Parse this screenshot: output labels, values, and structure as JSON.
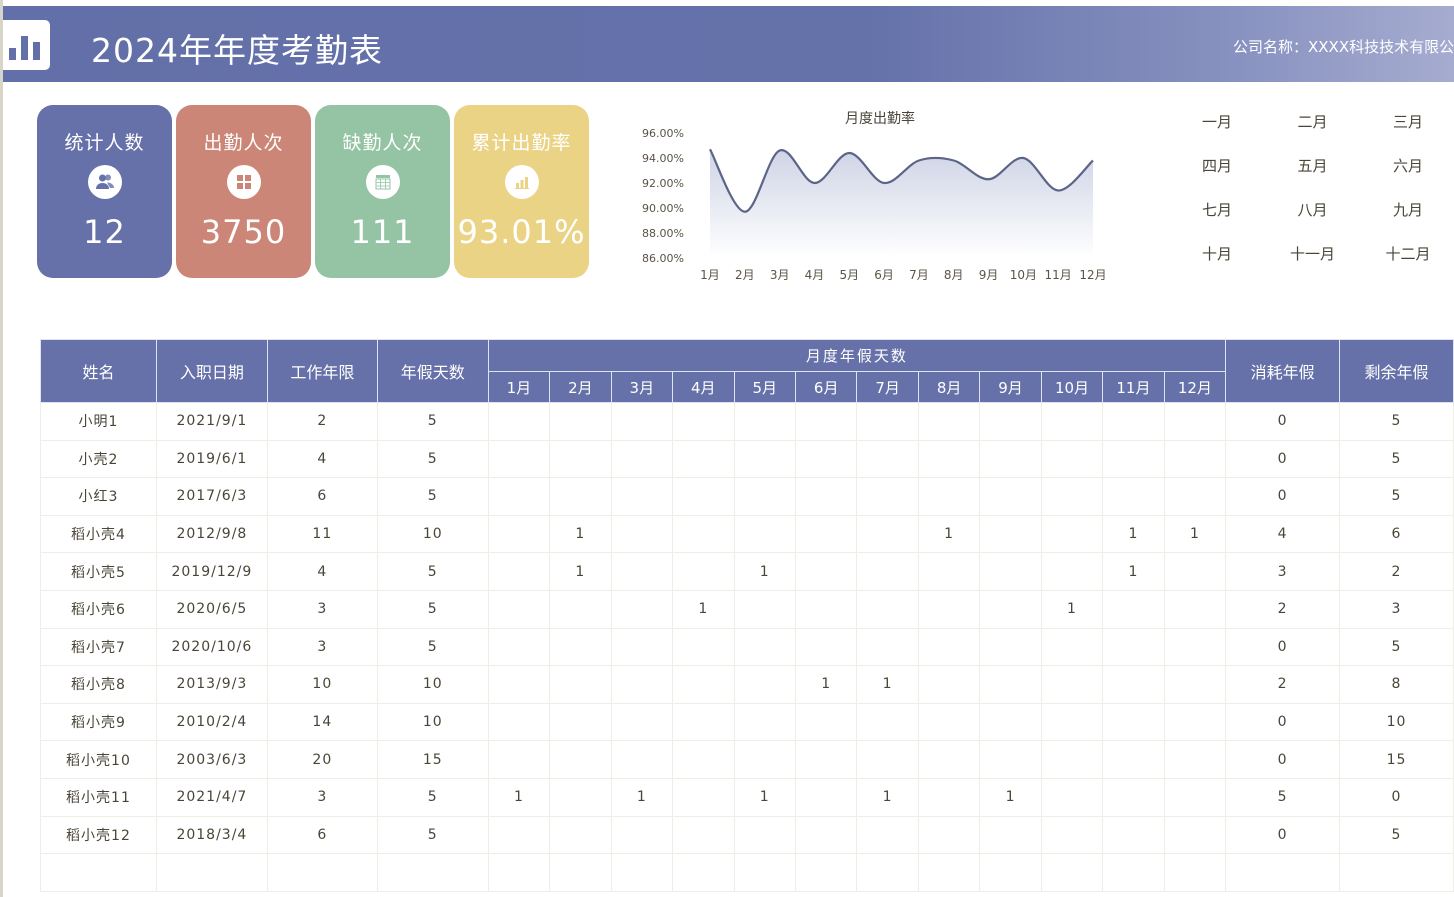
{
  "header": {
    "title": "2024年年度考勤表",
    "company": "公司名称：XXXX科技技术有限公",
    "logo_icon": "bar-chart-icon"
  },
  "kpis": [
    {
      "label": "统计人数",
      "value": "12",
      "icon": "users-icon",
      "color": "#6571a8"
    },
    {
      "label": "出勤人次",
      "value": "3750",
      "icon": "grid-icon",
      "color": "#cc8677"
    },
    {
      "label": "缺勤人次",
      "value": "111",
      "icon": "calendar-table-icon",
      "color": "#94c4a4"
    },
    {
      "label": "累计出勤率",
      "value": "93.01%",
      "icon": "bar-chart-icon",
      "color": "#ebd386"
    }
  ],
  "chart_data": {
    "type": "area",
    "title": "月度出勤率",
    "categories": [
      "1月",
      "2月",
      "3月",
      "4月",
      "5月",
      "6月",
      "7月",
      "8月",
      "9月",
      "10月",
      "11月",
      "12月"
    ],
    "series": [
      {
        "name": "出勤率",
        "values": [
          94.7,
          89.7,
          94.6,
          92.0,
          94.4,
          92.0,
          93.8,
          93.8,
          92.3,
          94.0,
          91.4,
          93.8
        ]
      }
    ],
    "ylim": [
      86,
      96
    ],
    "yticks": [
      "96.00%",
      "94.00%",
      "92.00%",
      "90.00%",
      "88.00%",
      "86.00%"
    ],
    "xlabel": "",
    "ylabel": "",
    "grid": false,
    "line_color": "#5c6488",
    "fill_color": "#c9cfe3"
  },
  "month_selector": [
    "一月",
    "二月",
    "三月",
    "四月",
    "五月",
    "六月",
    "七月",
    "八月",
    "九月",
    "十月",
    "十一月",
    "十二月"
  ],
  "table": {
    "headers": {
      "name": "姓名",
      "hire_date": "入职日期",
      "years": "工作年限",
      "leave_days": "年假天数",
      "monthly_group": "月度年假天数",
      "used": "消耗年假",
      "remaining": "剩余年假"
    },
    "months": [
      "1月",
      "2月",
      "3月",
      "4月",
      "5月",
      "6月",
      "7月",
      "8月",
      "9月",
      "10月",
      "11月",
      "12月"
    ],
    "rows": [
      {
        "name": "小明1",
        "hire_date": "2021/9/1",
        "years": "2",
        "leave_days": "5",
        "monthly": [
          "",
          "",
          "",
          "",
          "",
          "",
          "",
          "",
          "",
          "",
          "",
          ""
        ],
        "used": "0",
        "remaining": "5"
      },
      {
        "name": "小壳2",
        "hire_date": "2019/6/1",
        "years": "4",
        "leave_days": "5",
        "monthly": [
          "",
          "",
          "",
          "",
          "",
          "",
          "",
          "",
          "",
          "",
          "",
          ""
        ],
        "used": "0",
        "remaining": "5"
      },
      {
        "name": "小红3",
        "hire_date": "2017/6/3",
        "years": "6",
        "leave_days": "5",
        "monthly": [
          "",
          "",
          "",
          "",
          "",
          "",
          "",
          "",
          "",
          "",
          "",
          ""
        ],
        "used": "0",
        "remaining": "5"
      },
      {
        "name": "稻小壳4",
        "hire_date": "2012/9/8",
        "years": "11",
        "leave_days": "10",
        "monthly": [
          "",
          "1",
          "",
          "",
          "",
          "",
          "",
          "1",
          "",
          "",
          "1",
          "1"
        ],
        "used": "4",
        "remaining": "6"
      },
      {
        "name": "稻小壳5",
        "hire_date": "2019/12/9",
        "years": "4",
        "leave_days": "5",
        "monthly": [
          "",
          "1",
          "",
          "",
          "1",
          "",
          "",
          "",
          "",
          "",
          "1",
          ""
        ],
        "used": "3",
        "remaining": "2"
      },
      {
        "name": "稻小壳6",
        "hire_date": "2020/6/5",
        "years": "3",
        "leave_days": "5",
        "monthly": [
          "",
          "",
          "",
          "1",
          "",
          "",
          "",
          "",
          "",
          "1",
          "",
          ""
        ],
        "used": "2",
        "remaining": "3"
      },
      {
        "name": "稻小壳7",
        "hire_date": "2020/10/6",
        "years": "3",
        "leave_days": "5",
        "monthly": [
          "",
          "",
          "",
          "",
          "",
          "",
          "",
          "",
          "",
          "",
          "",
          ""
        ],
        "used": "0",
        "remaining": "5"
      },
      {
        "name": "稻小壳8",
        "hire_date": "2013/9/3",
        "years": "10",
        "leave_days": "10",
        "monthly": [
          "",
          "",
          "",
          "",
          "",
          "1",
          "1",
          "",
          "",
          "",
          "",
          ""
        ],
        "used": "2",
        "remaining": "8"
      },
      {
        "name": "稻小壳9",
        "hire_date": "2010/2/4",
        "years": "14",
        "leave_days": "10",
        "monthly": [
          "",
          "",
          "",
          "",
          "",
          "",
          "",
          "",
          "",
          "",
          "",
          ""
        ],
        "used": "0",
        "remaining": "10"
      },
      {
        "name": "稻小壳10",
        "hire_date": "2003/6/3",
        "years": "20",
        "leave_days": "15",
        "monthly": [
          "",
          "",
          "",
          "",
          "",
          "",
          "",
          "",
          "",
          "",
          "",
          ""
        ],
        "used": "0",
        "remaining": "15"
      },
      {
        "name": "稻小壳11",
        "hire_date": "2021/4/7",
        "years": "3",
        "leave_days": "5",
        "monthly": [
          "1",
          "",
          "1",
          "",
          "1",
          "",
          "1",
          "",
          "1",
          "",
          "",
          ""
        ],
        "used": "5",
        "remaining": "0"
      },
      {
        "name": "稻小壳12",
        "hire_date": "2018/3/4",
        "years": "6",
        "leave_days": "5",
        "monthly": [
          "",
          "",
          "",
          "",
          "",
          "",
          "",
          "",
          "",
          "",
          "",
          ""
        ],
        "used": "0",
        "remaining": "5"
      },
      {
        "name": "",
        "hire_date": "",
        "years": "",
        "leave_days": "",
        "monthly": [
          "",
          "",
          "",
          "",
          "",
          "",
          "",
          "",
          "",
          "",
          "",
          ""
        ],
        "used": "",
        "remaining": ""
      }
    ]
  }
}
